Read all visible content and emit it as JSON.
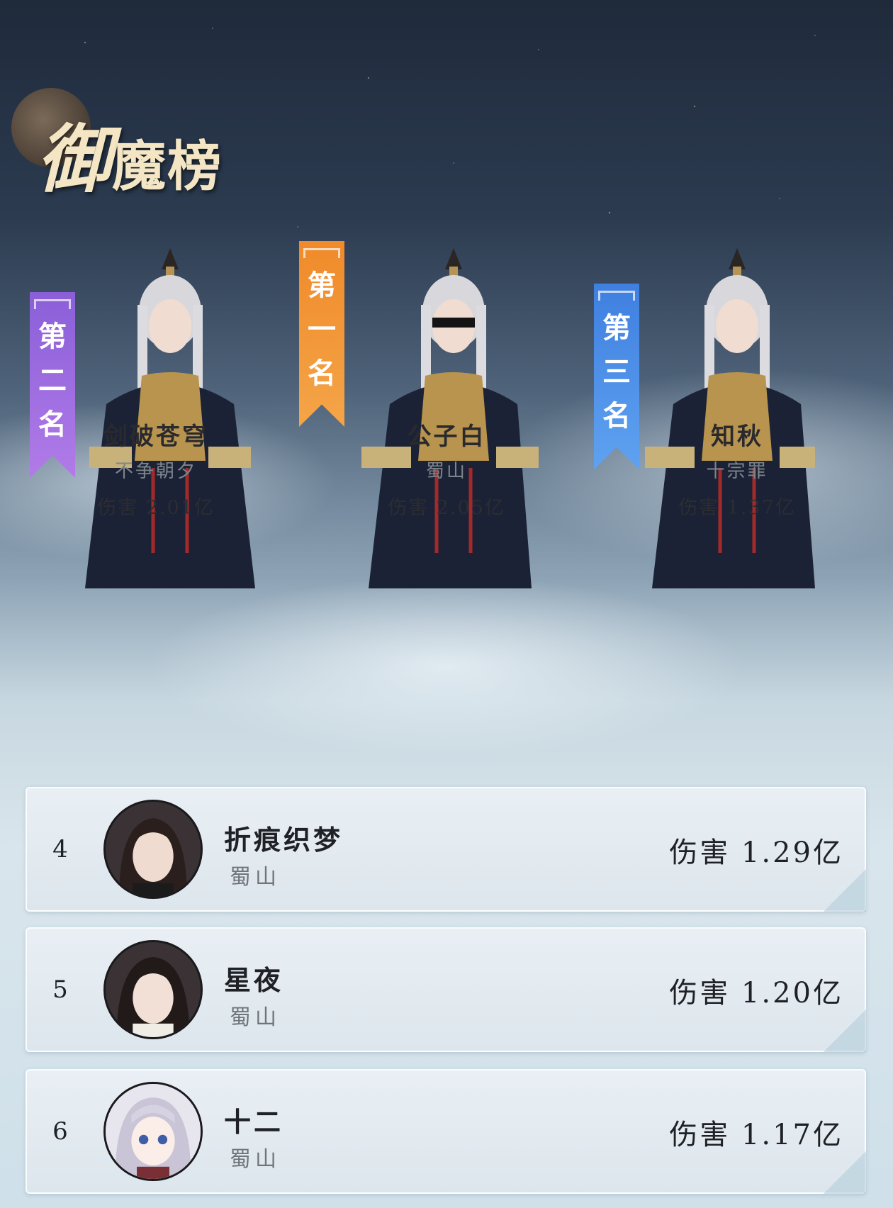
{
  "title": {
    "first": "御",
    "rest": "魔榜"
  },
  "podium": [
    {
      "banner": [
        "第",
        "二",
        "名"
      ],
      "name": "剑破苍穹",
      "guild": "不争朝夕",
      "damage": "伤害 2.01亿",
      "banner_color": "#9a6be0"
    },
    {
      "banner": [
        "第",
        "一",
        "名"
      ],
      "name": "公子白",
      "guild": "蜀山",
      "damage": "伤害 2.05亿",
      "banner_color": "#f08a2a"
    },
    {
      "banner": [
        "第",
        "三",
        "名"
      ],
      "name": "知秋",
      "guild": "十宗罪",
      "damage": "伤害 1.37亿",
      "banner_color": "#4a8ae6"
    }
  ],
  "ranking": [
    {
      "rank": "4",
      "name": "折痕织梦",
      "guild": "蜀山",
      "damage": "伤害 1.29亿"
    },
    {
      "rank": "5",
      "name": "星夜",
      "guild": "蜀山",
      "damage": "伤害 1.20亿"
    },
    {
      "rank": "6",
      "name": "十二",
      "guild": "蜀山",
      "damage": "伤害 1.17亿"
    }
  ]
}
